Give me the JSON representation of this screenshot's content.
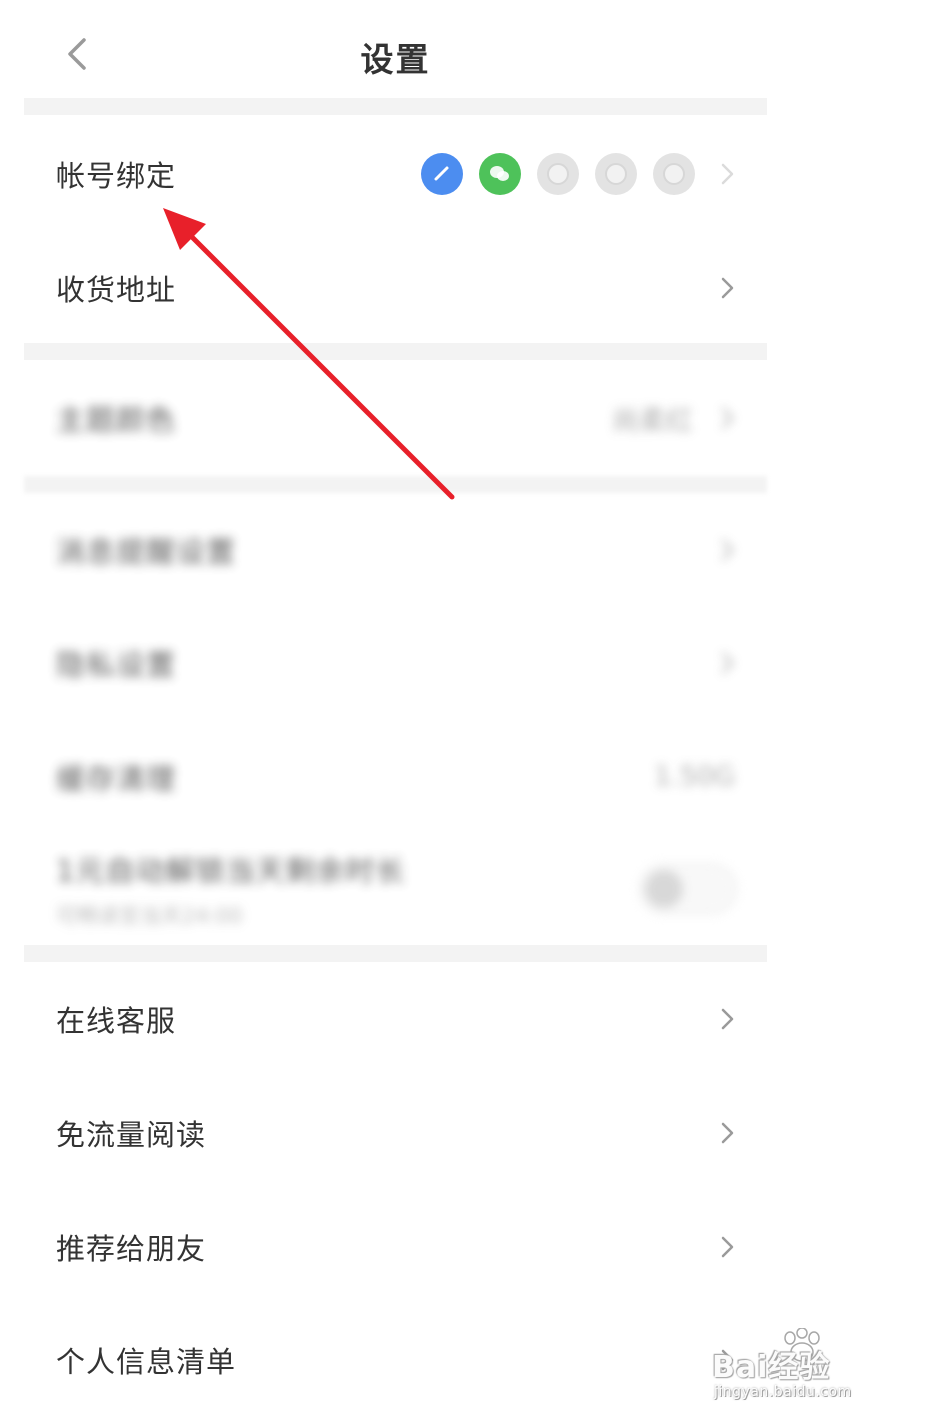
{
  "header": {
    "title": "设置"
  },
  "sections": [
    {
      "rows": [
        {
          "key": "account",
          "label": "帐号绑定",
          "social": [
            "blue",
            "green",
            "gray",
            "gray",
            "gray"
          ],
          "chevron": true
        },
        {
          "key": "address",
          "label": "收货地址",
          "chevron": true
        }
      ]
    },
    {
      "rows": [
        {
          "key": "theme",
          "label": "主题颜色",
          "value": "尚柔红",
          "chevron": true,
          "blurred": true
        }
      ]
    },
    {
      "rows": [
        {
          "key": "notify",
          "label": "消息提醒设置",
          "chevron": true,
          "blurred": true
        },
        {
          "key": "privacy",
          "label": "隐私设置",
          "chevron": true,
          "blurred": true
        },
        {
          "key": "cache",
          "label": "缓存清理",
          "value": "1.50G",
          "blurred": true
        },
        {
          "key": "unlock",
          "label": "1元自动解锁当天剩余时长",
          "sub": "可畅读至当天24:00",
          "toggle": false,
          "blurred": true
        }
      ]
    },
    {
      "rows": [
        {
          "key": "service",
          "label": "在线客服",
          "chevron": true
        },
        {
          "key": "freeflow",
          "label": "免流量阅读",
          "chevron": true
        },
        {
          "key": "recommend",
          "label": "推荐给朋友",
          "chevron": true
        },
        {
          "key": "personal",
          "label": "个人信息清单",
          "chevron": true
        }
      ]
    }
  ],
  "watermark": {
    "brand": "Bai经验",
    "url": "jingyan.baidu.com"
  },
  "colors": {
    "annotation_arrow": "#e8202a",
    "section_gap": "#f3f3f3",
    "text": "#333333"
  }
}
